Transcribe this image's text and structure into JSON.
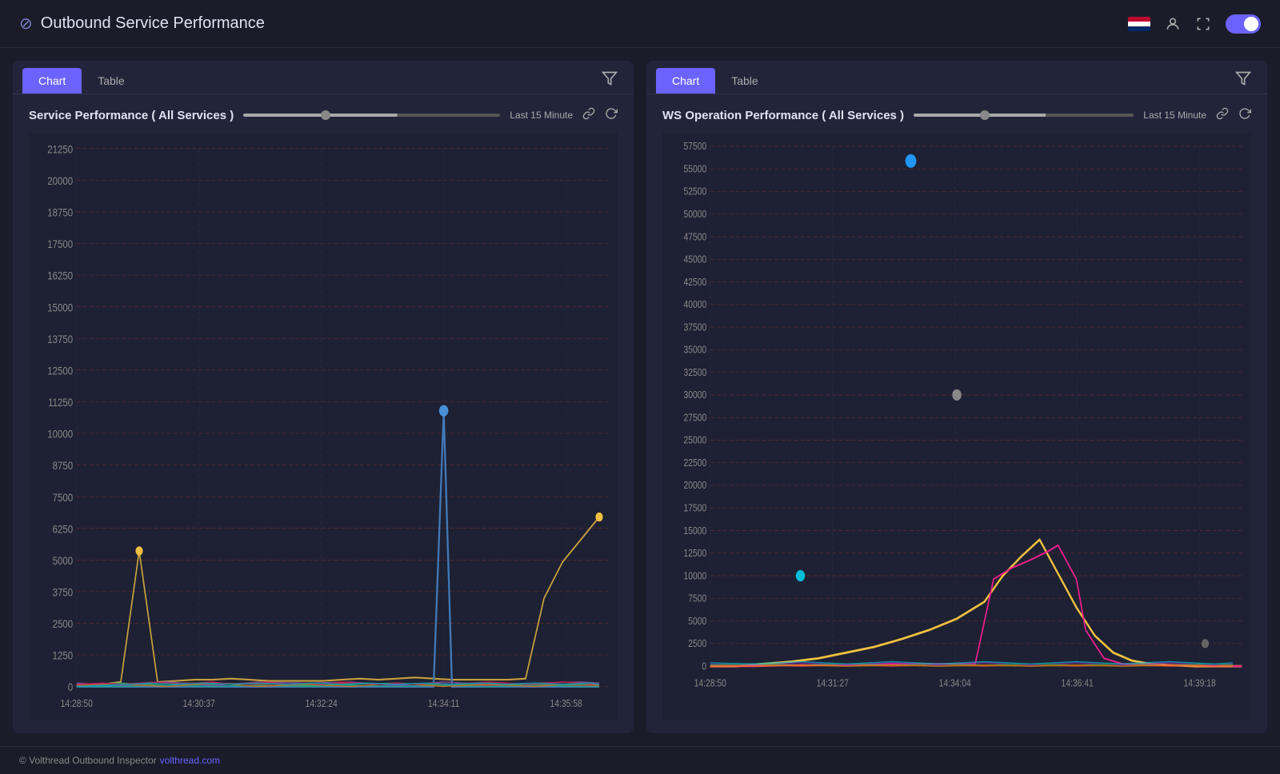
{
  "header": {
    "title": "Outbound Service Performance",
    "logo_icon": "⊘"
  },
  "panels": [
    {
      "id": "panel-left",
      "tabs": [
        "Chart",
        "Table"
      ],
      "active_tab": "Chart",
      "chart_title": "Service Performance ( All Services )",
      "time_label": "Last 15 Minute",
      "y_axis_labels": [
        "21250",
        "20000",
        "18750",
        "17500",
        "16250",
        "15000",
        "13750",
        "12500",
        "11250",
        "10000",
        "8750",
        "7500",
        "6250",
        "5000",
        "3750",
        "2500",
        "1250",
        "0"
      ],
      "x_axis_labels": [
        "14:28:50",
        "14:30:37",
        "14:32:24",
        "14:34:11",
        "14:35:58"
      ]
    },
    {
      "id": "panel-right",
      "tabs": [
        "Chart",
        "Table"
      ],
      "active_tab": "Chart",
      "chart_title": "WS Operation Performance ( All Services )",
      "time_label": "Last 15 Minute",
      "y_axis_labels": [
        "57500",
        "55000",
        "52500",
        "50000",
        "47500",
        "45000",
        "42500",
        "40000",
        "37500",
        "35000",
        "32500",
        "30000",
        "27500",
        "25000",
        "22500",
        "20000",
        "17500",
        "15000",
        "12500",
        "10000",
        "7500",
        "5000",
        "2500",
        "0"
      ],
      "x_axis_labels": [
        "14:28:50",
        "14:31:27",
        "14:34:04",
        "14:36:41",
        "14:39:18"
      ]
    }
  ],
  "footer": {
    "text": "© Volthread Outbound Inspector",
    "link_text": "volthread.com",
    "link_url": "#"
  }
}
